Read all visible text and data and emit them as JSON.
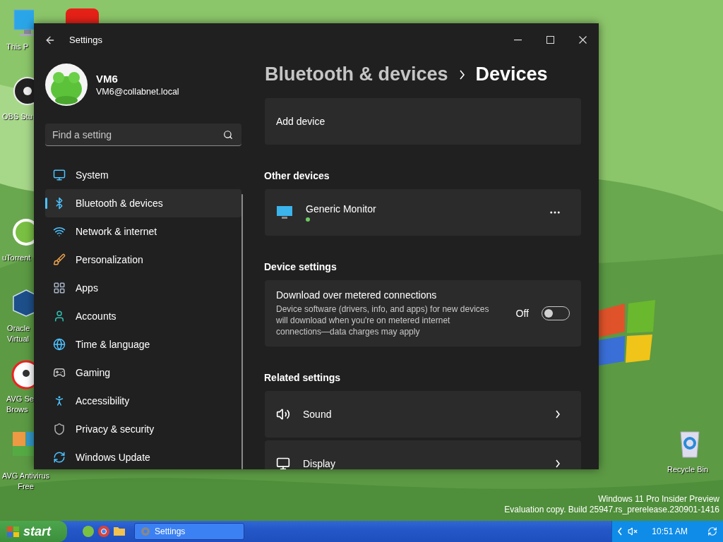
{
  "desktop_icons": [
    {
      "label": [
        "This P"
      ]
    },
    {
      "label": [
        "OBS Stu"
      ]
    },
    {
      "label": [
        "uTorrent"
      ]
    },
    {
      "label": [
        "Oracle",
        "Virtual"
      ]
    },
    {
      "label": [
        "AVG Se",
        "Brows"
      ]
    },
    {
      "label": [
        "AVG Antivirus",
        "Free"
      ]
    },
    {
      "label": [
        "Recycle Bin"
      ]
    }
  ],
  "os_notice": [
    "Windows 11 Pro Insider Preview",
    "Evaluation copy. Build 25947.rs_prerelease.230901-1416"
  ],
  "window": {
    "title": "Settings"
  },
  "user": {
    "name": "VM6",
    "email": "VM6@collabnet.local"
  },
  "search": {
    "placeholder": "Find a setting"
  },
  "nav": [
    {
      "label": "System",
      "selected": false
    },
    {
      "label": "Bluetooth & devices",
      "selected": true
    },
    {
      "label": "Network & internet",
      "selected": false
    },
    {
      "label": "Personalization",
      "selected": false
    },
    {
      "label": "Apps",
      "selected": false
    },
    {
      "label": "Accounts",
      "selected": false
    },
    {
      "label": "Time & language",
      "selected": false
    },
    {
      "label": "Gaming",
      "selected": false
    },
    {
      "label": "Accessibility",
      "selected": false
    },
    {
      "label": "Privacy & security",
      "selected": false
    },
    {
      "label": "Windows Update",
      "selected": false
    }
  ],
  "breadcrumb": [
    "Bluetooth & devices",
    "Devices"
  ],
  "sections": [
    {
      "kind": "action",
      "title": "Add device"
    },
    {
      "kind": "heading",
      "text": "Other devices"
    },
    {
      "kind": "device",
      "title": "Generic Monitor",
      "connected": true
    },
    {
      "kind": "heading",
      "text": "Device settings"
    },
    {
      "kind": "toggle",
      "title": "Download over metered connections",
      "description": "Device software (drivers, info, and apps) for new devices will download when you're on metered internet connections—data charges may apply",
      "state_label": "Off",
      "on": false
    },
    {
      "kind": "heading",
      "text": "Related settings"
    },
    {
      "kind": "link",
      "title": "Sound"
    },
    {
      "kind": "link",
      "title": "Display"
    }
  ],
  "taskbar": {
    "start": "start",
    "tasks": [
      {
        "label": "Settings",
        "selected": false
      }
    ],
    "clock": "10:51 AM"
  }
}
